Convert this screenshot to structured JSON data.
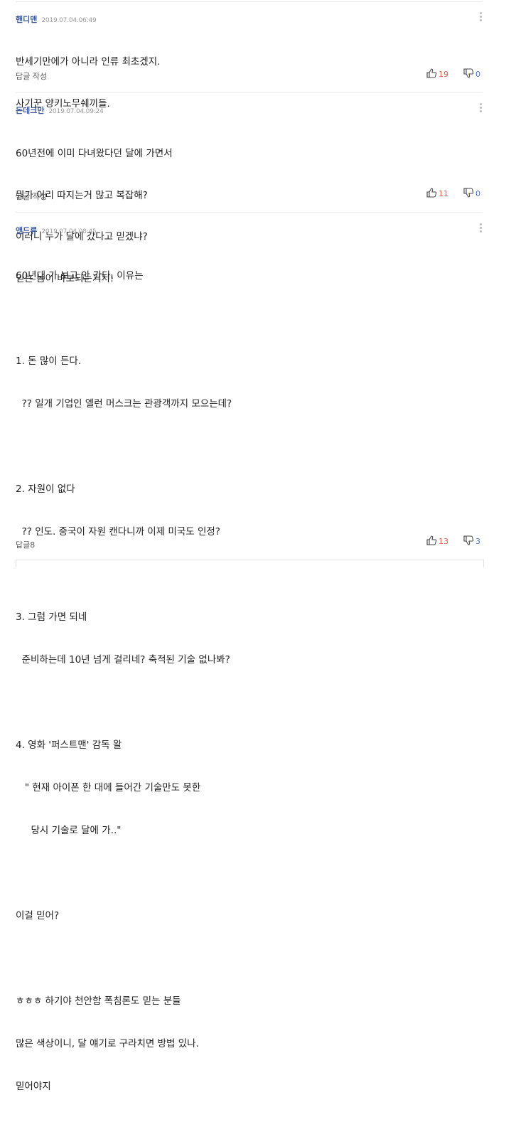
{
  "comments": [
    {
      "nickname": "핸디맨",
      "time": "2019.07.04.06:49",
      "lines": [
        "반세기만에가 아니라 인류 최초겠지.",
        "사기꾼 양키노무쉐끼들."
      ],
      "reply_label": "답글 작성",
      "likes": "19",
      "dislikes": "0"
    },
    {
      "nickname": "돈데크만",
      "time": "2019.07.04.09:24",
      "lines": [
        "60년전에 이미 다녀왔다던 달에 가면서",
        "뭐가 이리 따지는거 많고 복잡해?",
        "이러니 누가 달에 갔다고 믿겠냐?",
        "믿는 놈이 바보되는거지!"
      ],
      "reply_label": "답글 작성",
      "likes": "11",
      "dislikes": "0"
    },
    {
      "nickname": "앤드류",
      "time": "2019.07.04.08:45",
      "lines": [
        "60년대 가 보고 안 간다. 이유는",
        "",
        "1. 돈 많이 든다.",
        "  ?? 일개 기업인 엘런 머스크는 관광객까지 모으는데?",
        "",
        "2. 자원이 없다",
        "  ?? 인도. 중국이 자원 캔다니까 이제 미국도 인정?",
        "",
        "3. 그럼 가면 되네",
        "  준비하는데 10년 넘게 걸리네? 축적된 기술 없나봐?",
        "",
        "4. 영화 '퍼스트맨' 감독 왈",
        "   \" 현재 아이폰 한 대에 들어간 기술만도 못한",
        "     당시 기술로 달에 가..\"",
        "",
        "이걸 믿어?",
        "",
        "ㅎㅎㅎ 하기야 천안함 폭침론도 믿는 분들",
        "많은 색상이니, 달 얘기로 구라치면 방법 있나.",
        "믿어야지"
      ],
      "reply_label": "답글",
      "reply_count": "8",
      "likes": "13",
      "dislikes": "3"
    }
  ],
  "icons": {
    "like": "thumbs-up-icon",
    "dislike": "thumbs-down-icon",
    "more": "more-vertical-icon"
  },
  "colors": {
    "nickname": "#3f5b9a",
    "like_count": "#e05b4a",
    "dislike_count": "#4a78c2"
  }
}
